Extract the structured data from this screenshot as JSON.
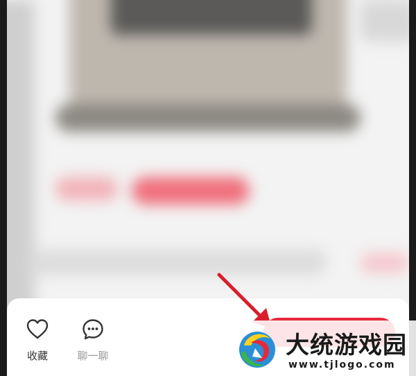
{
  "bottom_bar": {
    "favorite_label": "收藏",
    "chat_label": "聊一聊",
    "buy_button_color": "#e8283a"
  },
  "icons": {
    "favorite": "heart-outline-icon",
    "chat": "chat-bubble-icon"
  },
  "annotation": {
    "arrow_color": "#d81e2b"
  },
  "watermark": {
    "title": "大统游戏园",
    "url": "www.tjlogo.com"
  }
}
